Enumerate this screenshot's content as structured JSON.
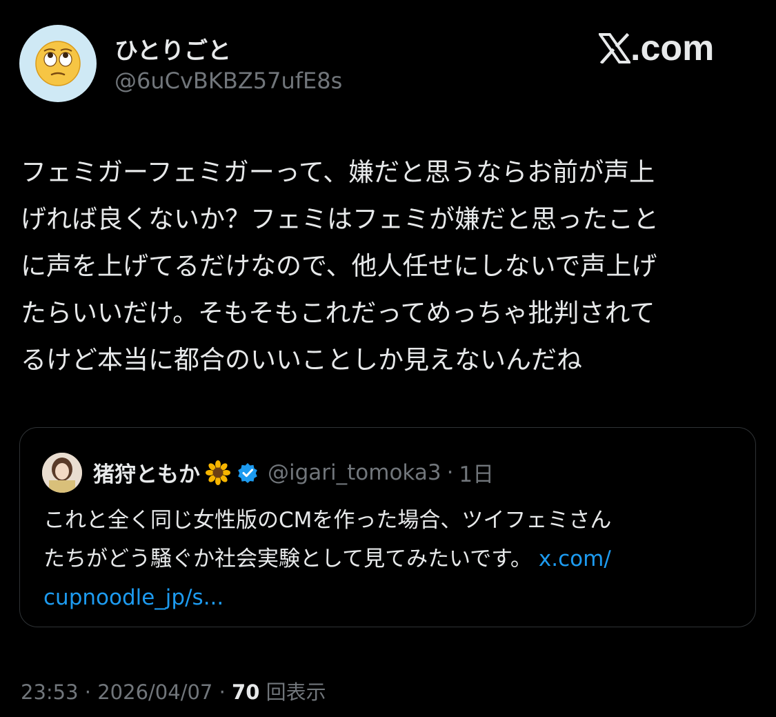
{
  "author": {
    "display_name": "ひとりごと",
    "handle": "@6uCvBKBZ57ufE8s",
    "avatar_icon": "face-with-rolling-eyes-icon"
  },
  "brand": {
    "label": "X.com",
    "icon": "x-logo-icon"
  },
  "tweet": {
    "lines": [
      "フェミガーフェミガーって、嫌だと思うならお前が声上",
      "げれば良くないか？フェミはフェミが嫌だと思ったこと",
      "に声を上げてるだけなので、他人任せにしないで声上げ",
      "たらいいだけ。そもそもこれだってめっちゃ批判されて",
      "るけど本当に都合のいいことしか見えないんだね"
    ]
  },
  "quote": {
    "display_name": "猪狩ともか",
    "name_emoji_icon": "sunflower-icon",
    "verified_icon": "verified-badge-icon",
    "handle": "@igari_tomoka3",
    "separator": "·",
    "time": "1日",
    "lines": [
      "これと全く同じ女性版のCMを作った場合、ツイフェミさん",
      "たちがどう騒ぐか社会実験として見てみたいです。 "
    ],
    "link_part1": "x.com/",
    "link_part2": "cupnoodle_jp/s...",
    "colors": {
      "link": "#1d9bf0",
      "verified": "#1d9bf0"
    }
  },
  "meta": {
    "time": "23:53",
    "sep1": " · ",
    "date": "2026/04/07",
    "sep2": " · ",
    "views_count": "70",
    "views_label": " 回表示"
  },
  "colors": {
    "background": "#000000",
    "text": "#e7e9ea",
    "muted": "#71767b",
    "border": "#2f3336"
  }
}
